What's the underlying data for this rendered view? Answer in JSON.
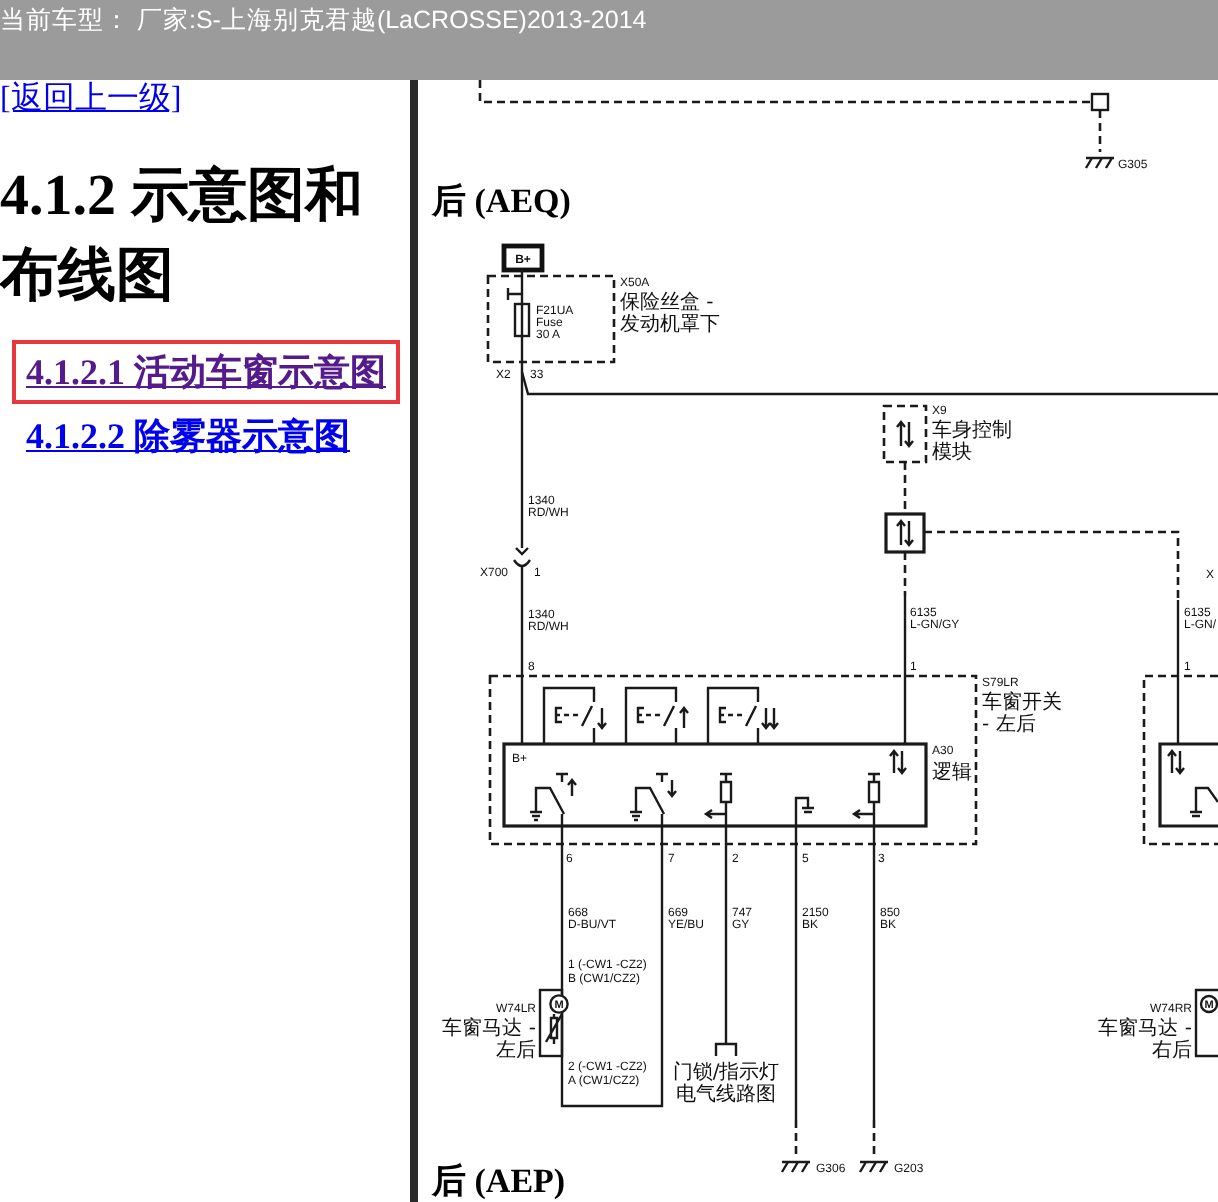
{
  "header": {
    "title": "当前车型： 厂家:S-上海别克君越(LaCROSSE)2013-2014"
  },
  "sidebar": {
    "back_link": "[返回上一级]",
    "heading": "4.1.2 示意图和布线图",
    "links": [
      {
        "label": "4.1.2.1 活动车窗示意图",
        "selected": true,
        "visited": true
      },
      {
        "label": "4.1.2.2 除雾器示意图",
        "selected": false,
        "visited": false
      }
    ]
  },
  "diagram": {
    "top_ground": "G305",
    "title": "后 (AEQ)",
    "power_terminal": "B+",
    "fuse_block": {
      "id": "X50A",
      "name": [
        "保险丝盒 -",
        "发动机罩下"
      ],
      "fuse": [
        "F21UA",
        "Fuse",
        "30 A"
      ],
      "connector": "X2",
      "pin": "33"
    },
    "supply_wires": [
      {
        "circuit": "1340",
        "color_code": "RD/WH"
      },
      {
        "circuit": "1340",
        "color_code": "RD/WH"
      }
    ],
    "inline_connector": {
      "id": "X700",
      "pin": "1"
    },
    "body_control_module": {
      "id": "X9",
      "name": [
        "车身控制",
        "模块"
      ]
    },
    "data_wire": {
      "circuit": "6135",
      "color_code": "L-GN/GY"
    },
    "window_switch": {
      "id": "S79LR",
      "name": [
        "车窗开关",
        "- 左后"
      ],
      "logic_id": "A30",
      "logic_name": "逻辑",
      "power_label": "B+",
      "top_pins": [
        "8",
        "1"
      ],
      "bottom_pins": [
        "6",
        "7",
        "2",
        "5",
        "3"
      ]
    },
    "output_wires": [
      {
        "circuit": "668",
        "color_code": "D-BU/VT"
      },
      {
        "circuit": "669",
        "color_code": "YE/BU"
      },
      {
        "circuit": "747",
        "color_code": "GY"
      },
      {
        "circuit": "2150",
        "color_code": "BK"
      },
      {
        "circuit": "850",
        "color_code": "BK"
      }
    ],
    "window_motor": {
      "id": "W74LR",
      "name": [
        "车窗马达 -",
        "左后"
      ],
      "symbol": "M",
      "pin_a": [
        "1 (-CW1 -CZ2)",
        "B (CW1/CZ2)"
      ],
      "pin_b": [
        "2 (-CW1 -CZ2)",
        "A (CW1/CZ2)"
      ]
    },
    "lock_reference": [
      "门锁/指示灯",
      "电气线路图"
    ],
    "grounds": [
      "G306",
      "G203"
    ],
    "right_side": {
      "connector": "X",
      "circuit": "6135",
      "color_code": "L-GN/",
      "pin": "1",
      "motor_id": "W74RR",
      "motor_name": [
        "车窗马达 -",
        "右后"
      ],
      "motor_symbol": "M"
    },
    "next_title": "后 (AEP)"
  }
}
